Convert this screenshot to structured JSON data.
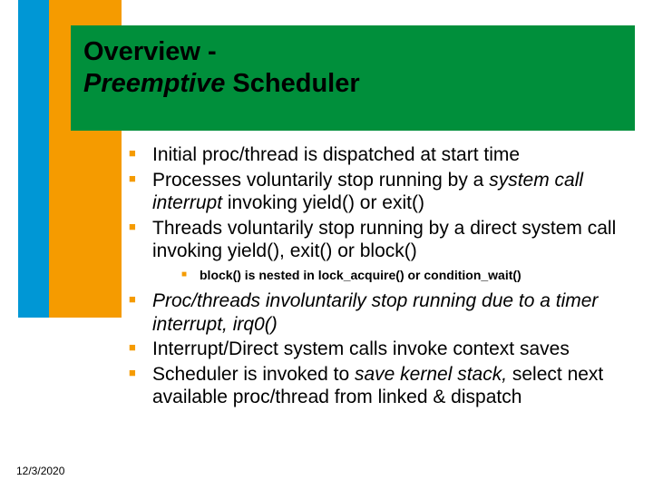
{
  "title": {
    "word1": "Overview -",
    "word2": "Preemptive",
    "word3": " Scheduler"
  },
  "bullets": {
    "b1": "Initial proc/thread is dispatched at start time",
    "b2_pre": "Processes voluntarily stop running by a ",
    "b2_it": "system call interrupt",
    "b2_post": " invoking yield() or exit()",
    "b3": "Threads voluntarily stop running by a direct system call invoking yield(), exit() or block()",
    "b3a": "block() is nested in lock_acquire() or condition_wait()",
    "b4_it": "Proc/threads involuntarily stop running due to a timer interrupt, irq0()",
    "b5": "Interrupt/Direct system calls invoke context saves",
    "b6_pre": "Scheduler is invoked to ",
    "b6_it": "save kernel stack,",
    "b6_post": " select next available proc/thread from linked & dispatch"
  },
  "footer": {
    "date": "12/3/2020"
  }
}
